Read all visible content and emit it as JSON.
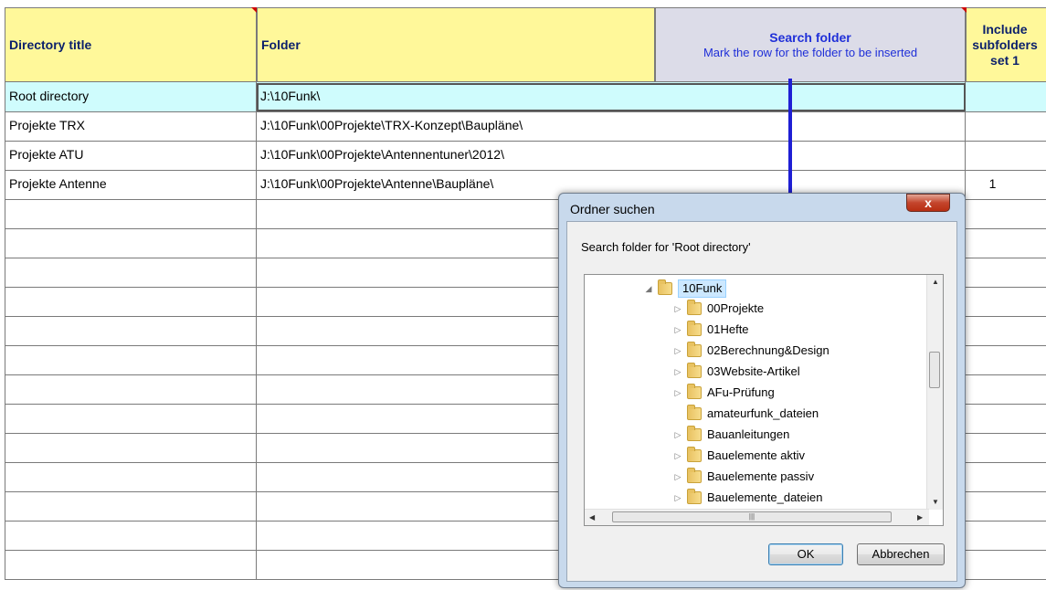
{
  "headers": {
    "directory_title": "Directory title",
    "folder": "Folder",
    "search_folder": "Search folder",
    "search_hint": "Mark the row for the folder to be inserted",
    "include_line1": "Include",
    "include_line2": "subfolders",
    "include_line3": "set 1"
  },
  "rows": [
    {
      "title": "Root directory",
      "folder": "J:\\10Funk\\",
      "include": ""
    },
    {
      "title": "Projekte TRX",
      "folder": "J:\\10Funk\\00Projekte\\TRX-Konzept\\Baupläne\\",
      "include": ""
    },
    {
      "title": "Projekte ATU",
      "folder": "J:\\10Funk\\00Projekte\\Antennentuner\\2012\\",
      "include": ""
    },
    {
      "title": "Projekte Antenne",
      "folder": "J:\\10Funk\\00Projekte\\Antenne\\Baupläne\\",
      "include": "1"
    }
  ],
  "dialog": {
    "title": "Ordner suchen",
    "close_label": "x",
    "prompt": "Search folder for 'Root directory'",
    "tree_root": "10Funk",
    "tree_items": [
      {
        "label": "00Projekte",
        "expandable": true
      },
      {
        "label": "01Hefte",
        "expandable": true
      },
      {
        "label": "02Berechnung&Design",
        "expandable": true
      },
      {
        "label": "03Website-Artikel",
        "expandable": true
      },
      {
        "label": "AFu-Prüfung",
        "expandable": true
      },
      {
        "label": "amateurfunk_dateien",
        "expandable": false
      },
      {
        "label": "Bauanleitungen",
        "expandable": true
      },
      {
        "label": "Bauelemente aktiv",
        "expandable": true
      },
      {
        "label": "Bauelemente passiv",
        "expandable": true
      },
      {
        "label": "Bauelemente_dateien",
        "expandable": true
      }
    ],
    "ok_label": "OK",
    "cancel_label": "Abbrechen"
  },
  "colors": {
    "header_yellow": "#fff89a",
    "selected_row": "#cffcfd",
    "arrow_blue": "#1f1fd4"
  }
}
